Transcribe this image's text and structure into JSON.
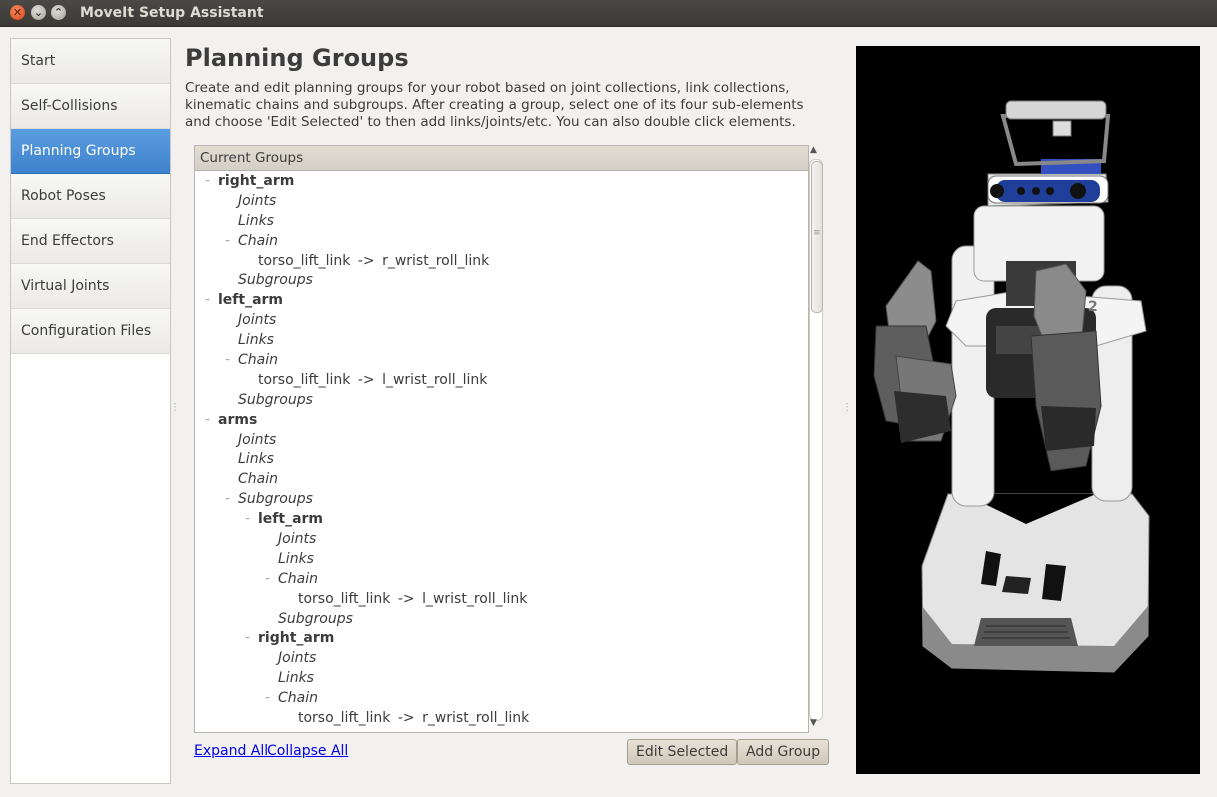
{
  "window": {
    "title": "MoveIt Setup Assistant",
    "close_glyph": "✕",
    "min_glyph": "⌄",
    "max_glyph": "⌃"
  },
  "nav": {
    "items": [
      "Start",
      "Self-Collisions",
      "Planning Groups",
      "Robot Poses",
      "End Effectors",
      "Virtual Joints",
      "Configuration Files"
    ],
    "active": "Planning Groups"
  },
  "header": {
    "title": "Planning Groups",
    "description": "Create and edit planning groups for your robot based on joint collections, link collections, kinematic chains and subgroups. After creating a group, select one of its four sub-elements and choose 'Edit Selected' to then add links/joints/etc. You can also double click elements."
  },
  "tree": {
    "header": "Current Groups",
    "rows": [
      {
        "text": "right_arm",
        "style": "group",
        "toggle": "–"
      },
      {
        "text": "Joints",
        "style": "item"
      },
      {
        "text": "Links",
        "style": "item"
      },
      {
        "text": "Chain",
        "style": "item",
        "toggle": "–"
      },
      {
        "text": "torso_lift_link  ->  r_wrist_roll_link",
        "style": "value"
      },
      {
        "text": "Subgroups",
        "style": "item"
      },
      {
        "text": "left_arm",
        "style": "group",
        "toggle": "–"
      },
      {
        "text": "Joints",
        "style": "item"
      },
      {
        "text": "Links",
        "style": "item"
      },
      {
        "text": "Chain",
        "style": "item",
        "toggle": "–"
      },
      {
        "text": "torso_lift_link  ->  l_wrist_roll_link",
        "style": "value"
      },
      {
        "text": "Subgroups",
        "style": "item"
      },
      {
        "text": "arms",
        "style": "group",
        "toggle": "–"
      },
      {
        "text": "Joints",
        "style": "item"
      },
      {
        "text": "Links",
        "style": "item"
      },
      {
        "text": "Chain",
        "style": "item"
      },
      {
        "text": "Subgroups",
        "style": "item",
        "toggle": "–"
      },
      {
        "text": "left_arm",
        "style": "group",
        "toggle": "–"
      },
      {
        "text": "Joints",
        "style": "item"
      },
      {
        "text": "Links",
        "style": "item"
      },
      {
        "text": "Chain",
        "style": "item",
        "toggle": "–"
      },
      {
        "text": "torso_lift_link  ->  l_wrist_roll_link",
        "style": "value"
      },
      {
        "text": "Subgroups",
        "style": "item"
      },
      {
        "text": "right_arm",
        "style": "group",
        "toggle": "–"
      },
      {
        "text": "Joints",
        "style": "item"
      },
      {
        "text": "Links",
        "style": "item"
      },
      {
        "text": "Chain",
        "style": "item",
        "toggle": "–"
      },
      {
        "text": "torso_lift_link  ->  r_wrist_roll_link",
        "style": "value"
      }
    ]
  },
  "scrollbar": {
    "up_glyph": "▲",
    "down_glyph": "▼",
    "grip_glyph": "≡",
    "position": 0
  },
  "actions": {
    "expand_all": "Expand All",
    "collapse_all": "Collapse All",
    "edit_selected": "Edit Selected",
    "add_group": "Add Group"
  },
  "splitter_glyph": "⋮",
  "robot": {
    "name_badge": "2"
  }
}
